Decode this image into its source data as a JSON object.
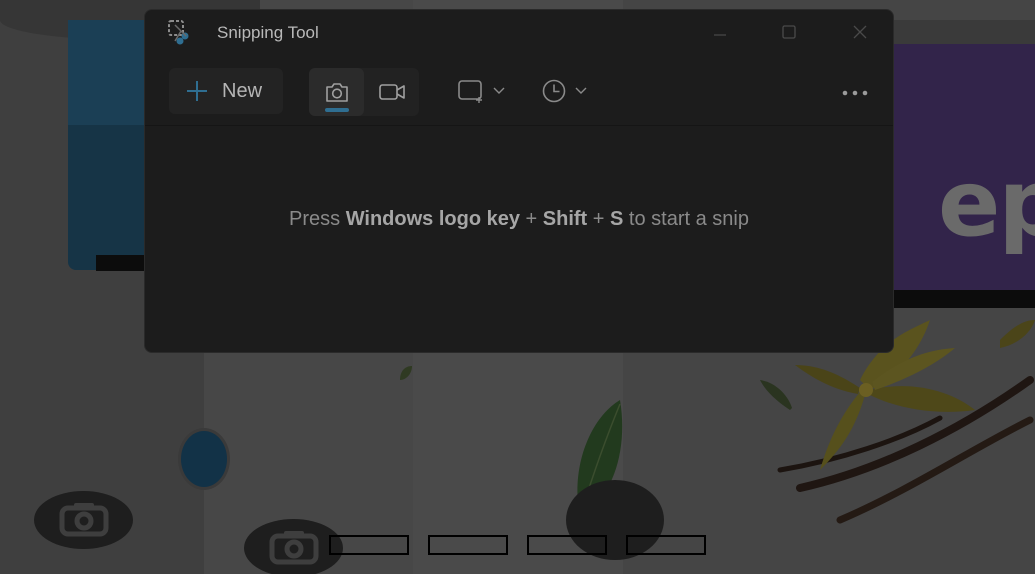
{
  "window": {
    "title": "Snipping Tool"
  },
  "toolbar": {
    "new_label": "New",
    "new_icon": "plus-icon",
    "snip_mode_icon": "camera-icon",
    "record_mode_icon": "video-camera-icon",
    "shape_icon": "rectangle-snip-icon",
    "delay_icon": "clock-icon",
    "more_icon": "more-horizontal-icon",
    "active_mode": "screenshot"
  },
  "hint": {
    "prefix": "Press ",
    "key1": "Windows logo key",
    "sep1": " + ",
    "key2": "Shift",
    "sep2": " + ",
    "key3": "S",
    "suffix": " to start a snip"
  },
  "background": {
    "headline_fragment": "epi"
  },
  "colors": {
    "window_bg": "#1c1c1c",
    "accent": "#2f6e91",
    "text": "#b9b9b9"
  }
}
